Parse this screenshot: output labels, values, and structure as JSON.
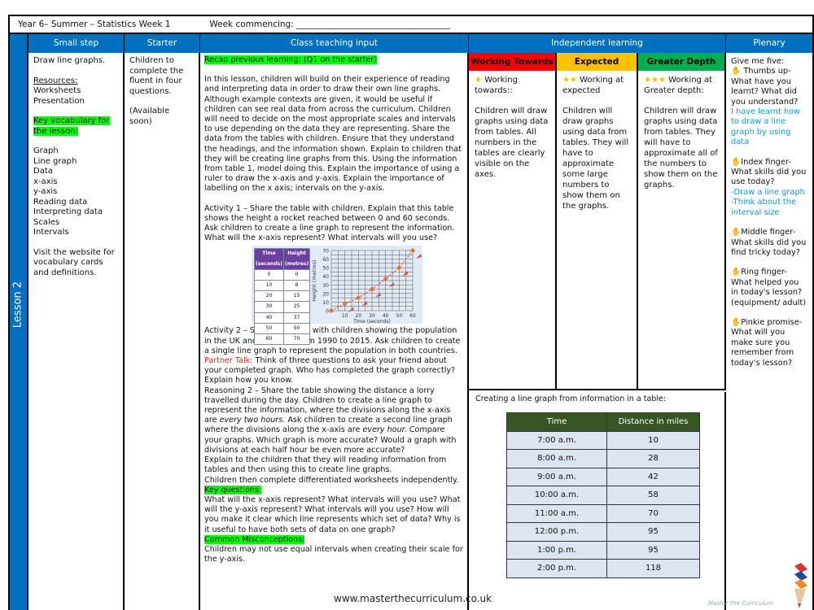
{
  "title": {
    "course": "Year 6– Summer – Statistics  Week 1",
    "week_commencing": "Week commencing: ____________________________________"
  },
  "headers": {
    "small_step": "Small step",
    "starter": "Starter",
    "class_teaching": "Class teaching input",
    "independent": "Independent learning",
    "plenary": "Plenary"
  },
  "lesson_label": "Lesson 2",
  "small_step": {
    "title": "Draw line graphs.",
    "resources_label": "Resources:",
    "resources": [
      "Worksheets",
      "Presentation"
    ],
    "vocab_label": "Key vocabulary for the lesson:",
    "vocab": [
      "Graph",
      "Line graph",
      "Data",
      "x-axis",
      "y-axis",
      "Reading data",
      "Interpreting data",
      "Scales",
      "Intervals"
    ],
    "website_note": "Visit the website for vocabulary cards and definitions."
  },
  "starter": {
    "text": "Children to complete the fluent in four questions.",
    "availability": "(Available soon)"
  },
  "teaching": {
    "recap": "Recap previous learning: (Q1 on the starter)",
    "intro": "In this lesson, children will build on their experience of reading and interpreting data in order to draw their own line graphs. Although example contexts are given, it would be useful if children can see real data from across the curriculum. Children will need to decide on the most appropriate scales and intervals to use depending on the data they are representing. Share the data from the tables with children. Ensure that they understand the headings, and the information shown. Explain to children that they will be creating line graphs from this. Using the information from table 1, model doing this. Explain the importance of using a ruler to draw the x-axis and y-axis. Explain the importance of labelling on the x axis; intervals on the y-axis.",
    "activity1": "Activity 1 – Share the table with children. Explain that this table shows the height a rocket reached between 0 and 60 seconds. Ask children to create a line graph to represent the information. What will the x-axis represent? What intervals will you use?",
    "activity2": "Activity 2 – Share the table with children showing the population in the UK and Australia from 1990 to 2015. Ask children to create a single line graph to represent the population in both countries.",
    "partner_label": "Partner Talk:",
    "partner_text": " Think of three questions to ask your friend about your completed graph. Who has completed the graph correctly? Explain how you know.",
    "reasoning_a": "Reasoning 2 – Share the table showing the distance a lorry travelled during the day. Children to create a line graph to represent the information, where the divisions along the x-axis are ",
    "reasoning_em1": "every two hours.",
    "reasoning_b": " Ask children to create a second line graph where the divisions along the x-axis are ",
    "reasoning_em2": "every hour.",
    "reasoning_c": " Compare your graphs. Which graph is more accurate? Would a graph with divisions at each half hour be even more accurate?",
    "explain": "Explain to the children that they will reading information from tables and then using this to create line graphs.",
    "worksheets": "Children then complete differentiated worksheets independently.",
    "key_q_label": "Key questions:",
    "key_q": "What will the x-axis represent? What intervals will you use? What will the y-axis represent? What intervals will you use? How will you make it clear which line represents which set of data? Why is it useful to have both sets of data on one graph?",
    "misconc_label": "Common Misconceptions:",
    "misconc": "Children may not use equal intervals when creating their scale for the y-axis.",
    "website": "www.masterthecurriculum.co.uk"
  },
  "rocket_table": {
    "headers": [
      "Time (seconds)",
      "Height (metres)"
    ],
    "rows": [
      [
        "0",
        "0"
      ],
      [
        "10",
        "8"
      ],
      [
        "20",
        "15"
      ],
      [
        "30",
        "25"
      ],
      [
        "40",
        "37"
      ],
      [
        "50",
        "50"
      ],
      [
        "60",
        "70"
      ]
    ]
  },
  "chart_data": {
    "type": "scatter",
    "title": "",
    "xlabel": "Time (seconds)",
    "ylabel": "Height (metres)",
    "x": [
      0,
      10,
      20,
      30,
      40,
      50,
      60
    ],
    "y": [
      0,
      8,
      15,
      25,
      37,
      50,
      70
    ],
    "xticks": [
      "10",
      "20",
      "30",
      "40",
      "50",
      "60"
    ],
    "yticks": [
      "0",
      "10",
      "20",
      "30",
      "40",
      "50",
      "60",
      "70"
    ],
    "xlim": [
      0,
      60
    ],
    "ylim": [
      0,
      70
    ],
    "grid": true,
    "trend_line": "dashed"
  },
  "independent": {
    "levels": [
      {
        "label": "Working Towards",
        "color": "#ff0000",
        "stars": "★",
        "heading": "Working towards::",
        "text": "Children will draw graphs using data from tables. All numbers in the tables are clearly visible on the axes."
      },
      {
        "label": "Expected",
        "color": "#ffc000",
        "stars": "★★",
        "heading": "Working at expected",
        "text": "Children will draw graphs using data from tables. They will have to approximate some large numbers to show them on the graphs."
      },
      {
        "label": "Greater Depth",
        "color": "#00b050",
        "stars": "★★★",
        "heading": "Working at Greater depth:",
        "text": "Children will draw graphs using data from tables. They will have to approximate all of the numbers to show them on the graphs."
      }
    ],
    "table_caption": "Creating a line graph from information in a table:",
    "distance_table": {
      "headers": [
        "Time",
        "Distance in miles"
      ],
      "rows": [
        [
          "7:00 a.m.",
          "10"
        ],
        [
          "8:00 a.m.",
          "28"
        ],
        [
          "9:00 a.m.",
          "42"
        ],
        [
          "10:00 a.m.",
          "58"
        ],
        [
          "11:00 a.m.",
          "70"
        ],
        [
          "12:00 p.m.",
          "95"
        ],
        [
          "1:00 p.m.",
          "95"
        ],
        [
          "2:00 p.m.",
          "118"
        ]
      ]
    }
  },
  "plenary": {
    "intro": "Give me five:",
    "thumb": " Thumbs up- What have you learnt? What did you understand?",
    "thumb_answer": "I have learnt how to draw a line graph by using data",
    "index": "Index finger- What skills did you use today?",
    "index_answer1": "-Draw a line graph",
    "index_answer2": "-Think about the interval size",
    "middle": "Middle finger- What skills did you find tricky today?",
    "ring": "Ring finger- What helped you in today's lesson? (equipment/ adult)",
    "pinkie": "Pinkie promise- What will you make sure you remember from today's lesson?"
  },
  "logo_text": "Master The Curriculum"
}
